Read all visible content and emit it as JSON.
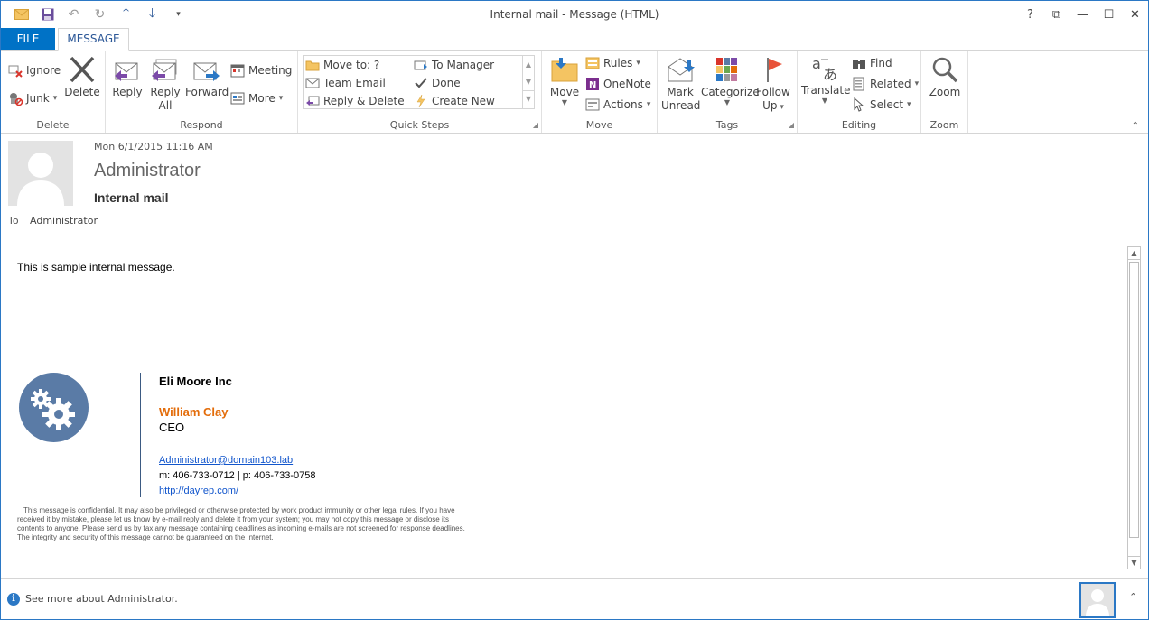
{
  "window": {
    "title": "Internal mail - Message (HTML)"
  },
  "qat": {
    "icons": [
      "mail-icon",
      "save-icon",
      "undo-icon",
      "redo-icon",
      "up-arrow-icon",
      "down-arrow-icon",
      "customize-icon"
    ]
  },
  "titlebar_controls": {
    "help": "?",
    "restore_ribbon": "⧉",
    "minimize": "—",
    "maximize": "☐",
    "close": "✕"
  },
  "tabs": {
    "file": "FILE",
    "message": "MESSAGE"
  },
  "ribbon": {
    "delete": {
      "label": "Delete",
      "ignore": "Ignore",
      "junk": "Junk",
      "delete": "Delete"
    },
    "respond": {
      "label": "Respond",
      "reply": "Reply",
      "reply_all_1": "Reply",
      "reply_all_2": "All",
      "forward": "Forward",
      "meeting": "Meeting",
      "more": "More"
    },
    "quick_steps": {
      "label": "Quick Steps",
      "move_to": "Move to: ?",
      "team_email": "Team Email",
      "reply_delete": "Reply & Delete",
      "to_manager": "To Manager",
      "done": "Done",
      "create_new": "Create New"
    },
    "move": {
      "label": "Move",
      "move": "Move",
      "rules": "Rules",
      "onenote": "OneNote",
      "actions": "Actions"
    },
    "tags": {
      "label": "Tags",
      "mark_unread_1": "Mark",
      "mark_unread_2": "Unread",
      "categorize": "Categorize",
      "follow_up_1": "Follow",
      "follow_up_2": "Up"
    },
    "editing": {
      "label": "Editing",
      "translate": "Translate",
      "find": "Find",
      "related": "Related",
      "select": "Select"
    },
    "zoom": {
      "label": "Zoom",
      "zoom": "Zoom"
    }
  },
  "message": {
    "date": "Mon 6/1/2015 11:16 AM",
    "sender": "Administrator",
    "subject": "Internal mail",
    "to_label": "To",
    "to_value": "Administrator",
    "body": "This is sample internal message.",
    "signature": {
      "company": "Eli Moore Inc",
      "name": "William Clay",
      "title": "CEO",
      "email": "Administrator@domain103.lab",
      "phone": "m:  406-733-0712 | p: 406-733-0758",
      "url": "http://dayrep.com/"
    },
    "disclaimer": "This message is confidential. It may also be privileged or otherwise protected by work product immunity or other legal rules. If you have received it by mistake, please let us know by e-mail reply and delete it from your system; you may not copy this message or disclose its contents to anyone. Please send us by fax any message containing deadlines as incoming e-mails are not screened for response deadlines. The integrity and security of this message cannot be guaranteed on the Internet."
  },
  "people_pane": {
    "see_more": "See more about Administrator."
  },
  "colors": {
    "accent": "#0072c6",
    "signature_name": "#e36c0a",
    "logo": "#5a7ba6",
    "link": "#1155cc"
  }
}
